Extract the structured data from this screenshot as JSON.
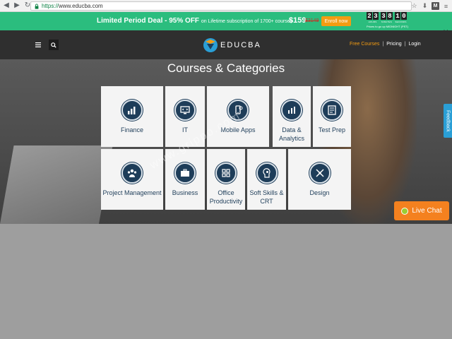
{
  "browser": {
    "url_scheme": "https://",
    "url_host": "www.educba.com",
    "nav_icons": [
      "back-icon",
      "forward-icon",
      "reload-icon"
    ],
    "right_icons": [
      "bookmark-star-icon",
      "download-icon",
      "extension-m-icon",
      "menu-icon"
    ]
  },
  "promo": {
    "headline": "Limited Period Deal - 95% OFF",
    "subline": "on Lifetime subscription of 1700+ courses",
    "price": "$159",
    "old_price": "$3149",
    "enroll_label": "Enroll now",
    "timer": {
      "hours": [
        "2",
        "3"
      ],
      "minutes": [
        "3",
        "8"
      ],
      "seconds": [
        "1",
        "0"
      ],
      "hours_label": "HOURS",
      "minutes_label": "MINUTES",
      "seconds_label": "SECONDS",
      "note": "Prices to go up MIDNIGHT (PST)"
    },
    "close_glyph": "✕"
  },
  "header": {
    "logo_text": "EDUCBA",
    "links": [
      "Free Courses",
      "Pricing",
      "Login"
    ],
    "separator": "|"
  },
  "hero": {
    "title": "Courses & Categories",
    "watermark": "www.grippo.com"
  },
  "categories": [
    {
      "label": "Finance",
      "icon": "finance-chart-icon"
    },
    {
      "label": "IT",
      "icon": "monitor-code-icon"
    },
    {
      "label": "Mobile Apps",
      "icon": "mobile-apps-icon"
    },
    {
      "label": "Data & Analytics",
      "icon": "bar-chart-icon"
    },
    {
      "label": "Test Prep",
      "icon": "test-document-icon"
    },
    {
      "label": "Project Management",
      "icon": "team-people-icon"
    },
    {
      "label": "Business",
      "icon": "briefcase-icon"
    },
    {
      "label": "Office Productivity",
      "icon": "office-grid-icon"
    },
    {
      "label": "Soft Skills & CRT",
      "icon": "head-gear-icon"
    },
    {
      "label": "Design",
      "icon": "design-tools-icon"
    }
  ],
  "feedback_label": "Feedback",
  "livechat_label": "Live Chat",
  "colors": {
    "promo_bg": "#2bbd7e",
    "accent_orange": "#f39c12",
    "brand_navy": "#1e3d59",
    "header_bg": "#2f2f2f"
  }
}
